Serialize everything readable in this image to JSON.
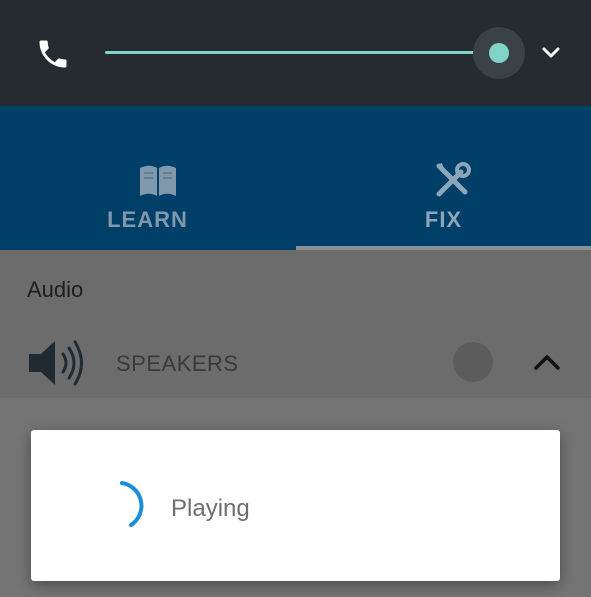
{
  "volume": {
    "stream_icon": "phone-icon",
    "level": 1.0,
    "expand_icon": "chevron-down-icon",
    "accent_color": "#7fd3c8"
  },
  "tabs": [
    {
      "label": "LEARN",
      "icon": "book-icon",
      "selected": false
    },
    {
      "label": "FIX",
      "icon": "tools-icon",
      "selected": true
    }
  ],
  "section": {
    "title": "Audio",
    "item_label": "SPEAKERS",
    "item_icon": "speaker-icon",
    "collapse_icon": "chevron-up-icon"
  },
  "dialog": {
    "message": "Playing",
    "spinner_color": "#1a8fd6"
  }
}
